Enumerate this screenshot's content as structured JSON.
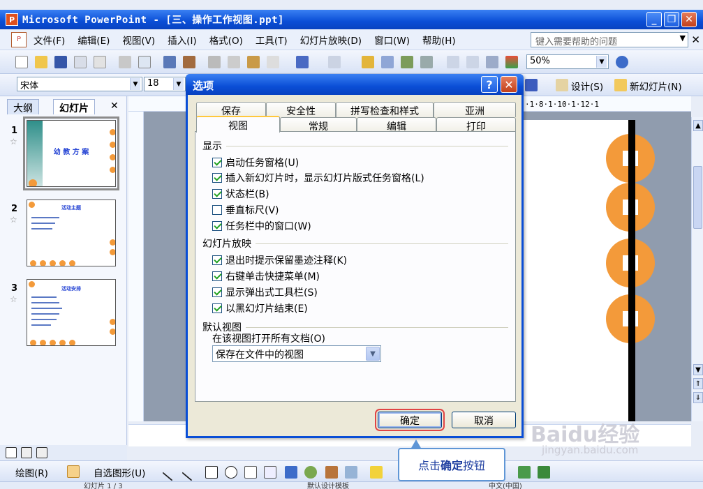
{
  "window": {
    "title": "Microsoft PowerPoint - [三、操作工作视图.ppt]",
    "minimize": "_",
    "restore": "❐",
    "close": "✕"
  },
  "menubar": {
    "items": [
      "文件(F)",
      "编辑(E)",
      "视图(V)",
      "插入(I)",
      "格式(O)",
      "工具(T)",
      "幻灯片放映(D)",
      "窗口(W)",
      "帮助(H)"
    ],
    "help_placeholder": "键入需要帮助的问题",
    "close_glyph": "✕"
  },
  "toolbar1": {
    "zoom": "50%"
  },
  "toolbar2": {
    "font": "宋体",
    "size": "18",
    "design": "设计(S)",
    "new_slide": "新幻灯片(N)"
  },
  "left_panel": {
    "tabs": [
      "大纲",
      "幻灯片"
    ],
    "close_glyph": "✕",
    "slides": [
      {
        "number": "1",
        "title": "幼 教 方 案"
      },
      {
        "number": "2",
        "title": "活动主题"
      },
      {
        "number": "3",
        "title": "活动安排"
      }
    ]
  },
  "ruler": {
    "top": "·1·8·1·10·1·12·1"
  },
  "dialog": {
    "title": "选项",
    "help_glyph": "?",
    "close_glyph": "✕",
    "tabs_row1": [
      "保存",
      "安全性",
      "拼写检查和样式",
      "亚洲"
    ],
    "tabs_row2": [
      "视图",
      "常规",
      "编辑",
      "打印"
    ],
    "group_display": "显示",
    "display_options": [
      {
        "label": "启动任务窗格(U)",
        "checked": true
      },
      {
        "label": "插入新幻灯片时，显示幻灯片版式任务窗格(L)",
        "checked": true
      },
      {
        "label": "状态栏(B)",
        "checked": true
      },
      {
        "label": "垂直标尺(V)",
        "checked": false
      },
      {
        "label": "任务栏中的窗口(W)",
        "checked": true
      }
    ],
    "group_slideshow": "幻灯片放映",
    "slideshow_options": [
      {
        "label": "退出时提示保留墨迹注释(K)",
        "checked": true
      },
      {
        "label": "右键单击快捷菜单(M)",
        "checked": true
      },
      {
        "label": "显示弹出式工具栏(S)",
        "checked": true
      },
      {
        "label": "以黑幻灯片结束(E)",
        "checked": true
      }
    ],
    "group_default_view": "默认视图",
    "open_all_label": "在该视图打开所有文档(O)",
    "default_view_value": "保存在文件中的视图",
    "ok_label": "确定",
    "cancel_label": "取消"
  },
  "drawbar": {
    "draw": "绘图(R)",
    "autoshapes": "自选图形(U)"
  },
  "statusbar": {
    "slide": "幻灯片 1 / 3",
    "design": "默认设计模板",
    "language": "中文(中国)"
  },
  "callout": {
    "prefix": "点击",
    "bold": "确定",
    "suffix": "按钮"
  },
  "watermark": {
    "logo": "Baidu经验",
    "url": "jingyan.baidu.com"
  },
  "colors": {
    "accent_blue": "#0a4ed6",
    "slide_orange": "#f39a3a",
    "highlight_red": "#e14444"
  }
}
